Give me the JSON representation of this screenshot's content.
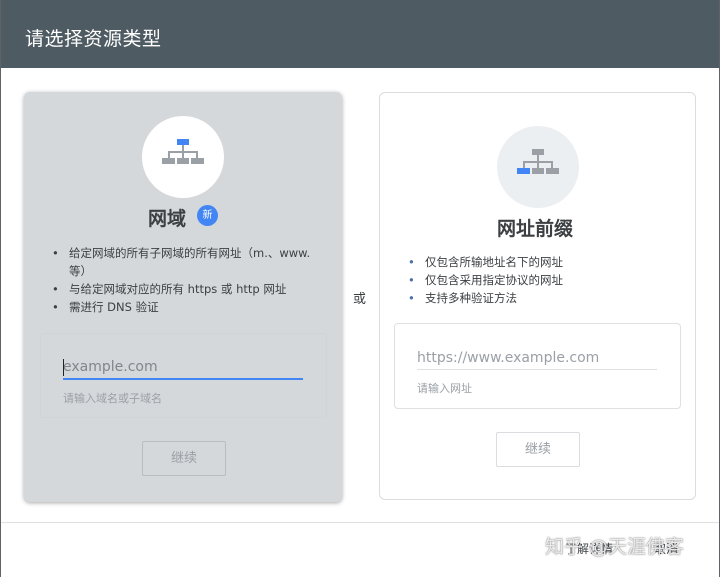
{
  "dialog": {
    "title": "请选择资源类型",
    "or_label": "或"
  },
  "domain_card": {
    "title": "网域",
    "badge": "新",
    "features": [
      "给定网域的所有子网域的所有网址（m.、www. 等）",
      "与给定网域对应的所有 https 或 http 网址",
      "需进行 DNS 验证"
    ],
    "input_placeholder": "example.com",
    "input_value": "",
    "helper": "请输入域名或子域名",
    "continue_label": "继续",
    "icon": "sitemap-icon"
  },
  "prefix_card": {
    "title": "网址前缀",
    "features": [
      "仅包含所输地址名下的网址",
      "仅包含采用指定协议的网址",
      "支持多种验证方法"
    ],
    "input_placeholder": "https://www.example.com",
    "input_value": "",
    "helper": "请输入网址",
    "continue_label": "继续",
    "icon": "sitemap-icon"
  },
  "footer": {
    "learn_more": "了解详情",
    "cancel": "取消"
  },
  "watermark": "知乎 @天涯佛客",
  "colors": {
    "header": "#4f5b62",
    "accent": "#4285f4",
    "selected_card": "#d4d8da"
  }
}
